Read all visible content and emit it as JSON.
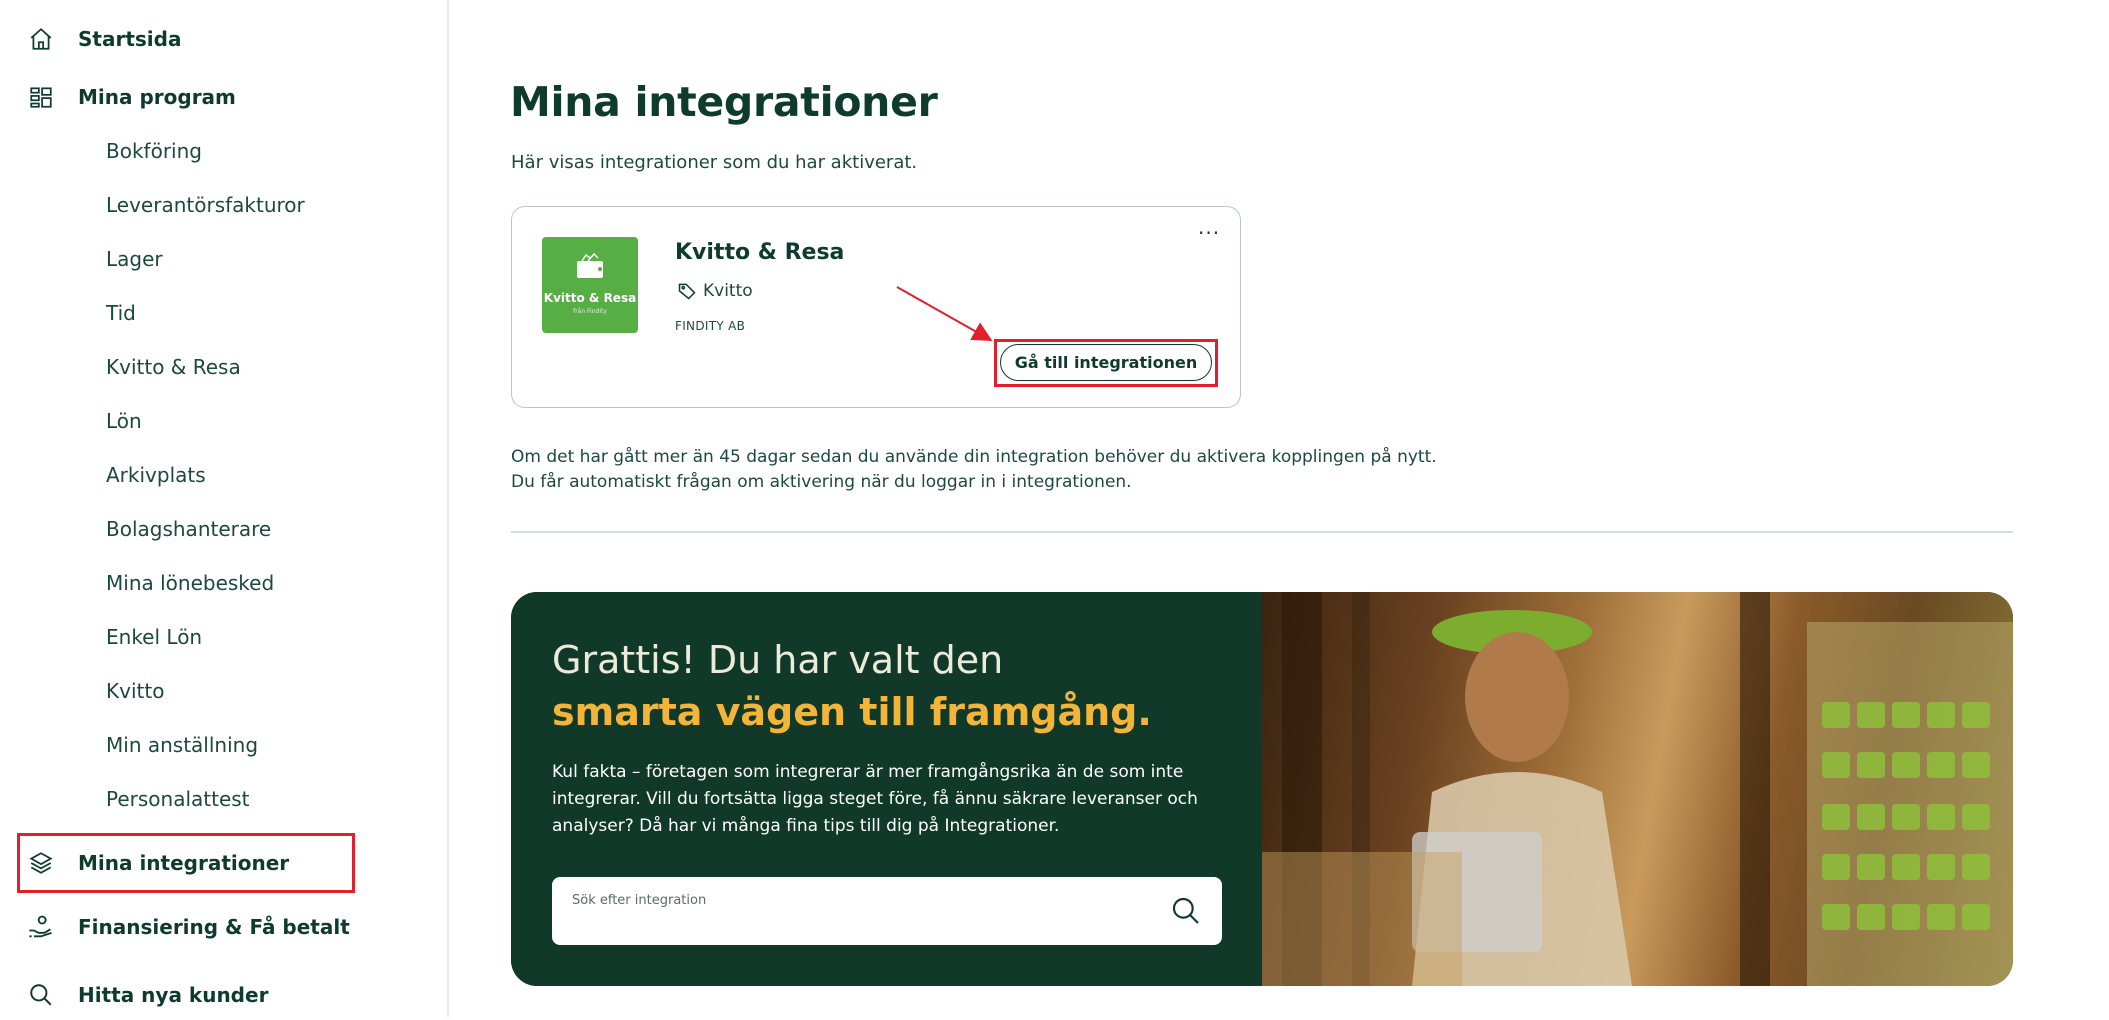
{
  "sidebar": {
    "home_label": "Startsida",
    "programs_label": "Mina program",
    "program_items": [
      "Bokföring",
      "Leverantörsfakturor",
      "Lager",
      "Tid",
      "Kvitto & Resa",
      "Lön",
      "Arkivplats",
      "Bolagshanterare",
      "Mina lönebesked",
      "Enkel Lön",
      "Kvitto",
      "Min anställning",
      "Personalattest"
    ],
    "integrations_label": "Mina integrationer",
    "finance_label": "Finansiering & Få betalt",
    "customers_label": "Hitta nya kunder"
  },
  "main": {
    "title": "Mina integrationer",
    "subtitle": "Här visas integrationer som du har aktiverat.",
    "card": {
      "logo_text": "Kvitto & Resa",
      "logo_tagline": "från Findity",
      "name": "Kvitto & Resa",
      "tag": "Kvitto",
      "vendor": "FINDITY AB",
      "more_label": "···",
      "button_label": "Gå till integrationen"
    },
    "note_line1": "Om det har gått mer än 45 dagar sedan du använde din integration behöver du aktivera kopplingen på nytt.",
    "note_line2": "Du får automatiskt frågan om aktivering när du loggar in i integrationen."
  },
  "banner": {
    "heading_line1": "Grattis! Du har valt den",
    "heading_line2": "smarta vägen till framgång.",
    "body_line1": "Kul fakta – företagen som integrerar är mer framgångsrika än de som inte",
    "body_line2": "integrerar. Vill du fortsätta ligga steget före, få ännu säkrare leveranser och",
    "body_line3": "analyser? Då har vi många fina tips till dig på Integrationer.",
    "search_placeholder": "Sök efter integration"
  },
  "colors": {
    "brand_dark": "#0e3b2c",
    "accent_yellow": "#f2b53a",
    "logo_green": "#56ae45",
    "highlight_red": "#e0202a"
  },
  "icons": {
    "home": "home-icon",
    "programs": "grid-icon",
    "integrations": "layers-icon",
    "finance": "hand-coin-icon",
    "customers": "search-icon",
    "tag": "tag-icon",
    "more": "more-dots-icon",
    "search": "search-icon"
  }
}
